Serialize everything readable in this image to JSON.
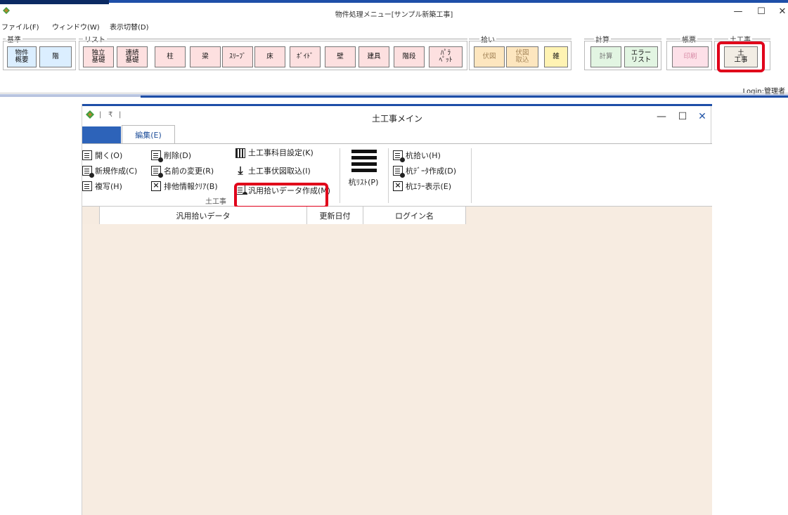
{
  "back_window": {
    "title": "物件処理メニュー[サンプル新築工事]",
    "menu": [
      "ファイル(F)",
      "ウィンドウ(W)",
      "表示切替(D)"
    ],
    "groups": {
      "kijun": "基準",
      "list": "リスト",
      "hiroi": "拾い",
      "keisan": "計算",
      "chohyo": "帳票",
      "dokoji": "土工事"
    },
    "buttons": {
      "bukken_gaiyo": "物件\n概要",
      "kai": "階",
      "dokuritsu_kiso": "独立\n基礎",
      "renzoku_kiso": "連続\n基礎",
      "hashira": "柱",
      "hari": "梁",
      "sleeve": "ｽﾘｰﾌﾞ",
      "yuka": "床",
      "void": "ﾎﾞｲﾄﾞ",
      "kabe": "壁",
      "tategu": "建具",
      "kaidan": "階段",
      "parapet": "ﾊﾟﾗ\nﾍﾟｯﾄ",
      "fukuzu": "伏図",
      "fukuzu_torikomi": "伏図\n取込",
      "zatsu": "雑",
      "keisan": "計算",
      "error_list": "エラー\nリスト",
      "insatsu": "印刷",
      "dokoji": "土\n工事"
    },
    "login": "Login:管理者",
    "window_controls": [
      "—",
      "☐",
      "✕"
    ]
  },
  "front_window": {
    "title": "土工事メイン",
    "quick_access": [
      "|",
      "₹",
      "|"
    ],
    "tabs": {
      "edit": "編集(E)"
    },
    "ribbon": {
      "open": "開く(O)",
      "new": "新規作成(C)",
      "copy": "複写(H)",
      "delete": "削除(D)",
      "rename": "名前の変更(R)",
      "clear_exclusive": "排他情報ｸﾘｱ(B)",
      "subject_setting": "土工事科目設定(K)",
      "fukuzu_import": "土工事伏図取込(I)",
      "hidden_item": "汎用拾いデータ作成(M)",
      "kui_list": "杭ﾘｽﾄ(P)",
      "kui_hiroi": "杭拾い(H)",
      "kui_data": "杭ﾃﾞｰﾀ作成(D)",
      "kui_error": "杭ｴﾗｰ表示(E)",
      "group_label": "土工事"
    },
    "grid": {
      "columns": [
        "汎用拾いデータ",
        "更新日付",
        "ログイン名"
      ]
    },
    "window_controls": [
      "—",
      "☐",
      "✕"
    ]
  },
  "colors": {
    "accent_blue": "#2d63b9",
    "highlight_red": "#e0001a",
    "grid_background": "#f7ece1"
  }
}
